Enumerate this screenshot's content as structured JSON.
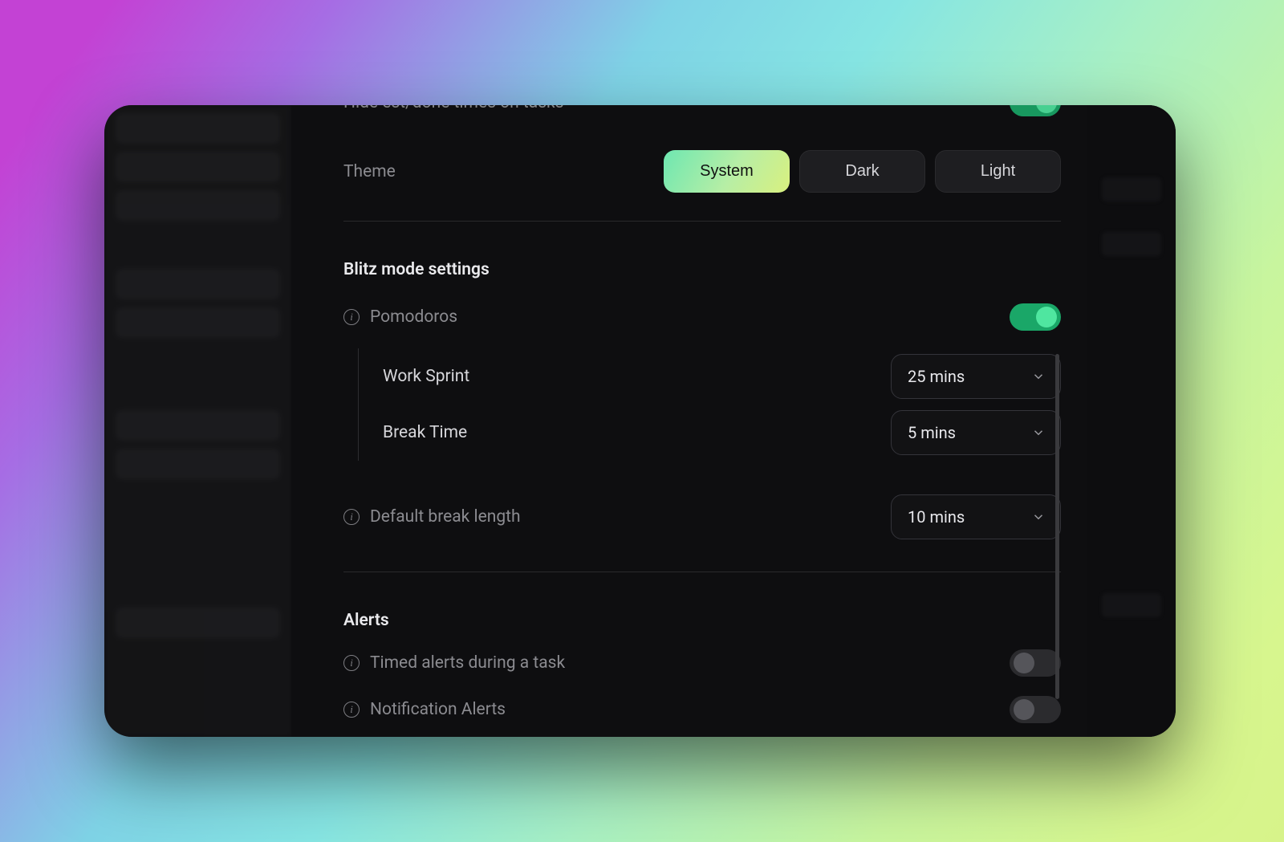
{
  "top": {
    "hide_est_done": "Hide est/done times on tasks",
    "hide_est_done_toggle": true,
    "theme_label": "Theme",
    "theme_options": {
      "system": "System",
      "dark": "Dark",
      "light": "Light"
    },
    "theme_selected": "system"
  },
  "blitz": {
    "section_title": "Blitz mode settings",
    "pomodoros_label": "Pomodoros",
    "pomodoros_toggle": true,
    "work_sprint_label": "Work Sprint",
    "work_sprint_value": "25 mins",
    "break_time_label": "Break Time",
    "break_time_value": "5 mins",
    "default_break_label": "Default break length",
    "default_break_value": "10 mins"
  },
  "alerts": {
    "section_title": "Alerts",
    "timed_label": "Timed alerts during a task",
    "timed_toggle": false,
    "notification_label": "Notification Alerts",
    "notification_toggle": false
  }
}
